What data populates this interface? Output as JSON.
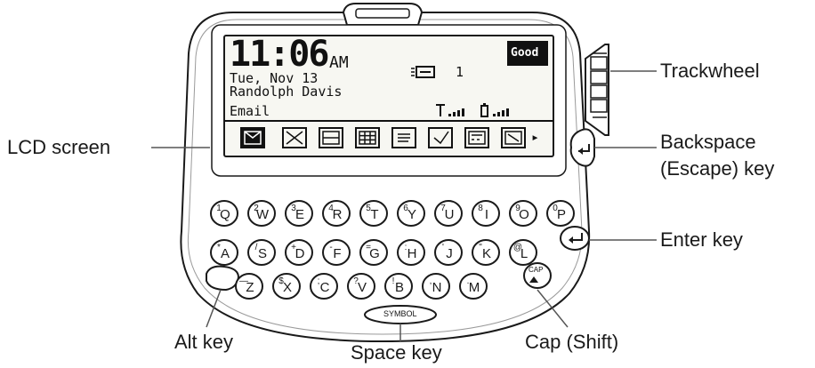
{
  "callouts": {
    "lcd_screen": "LCD screen",
    "trackwheel": "Trackwheel",
    "backspace_line1": "Backspace",
    "backspace_line2": "(Escape) key",
    "enter_key": "Enter key",
    "alt_key": "Alt key",
    "space_key": "Space key",
    "cap_shift": "Cap (Shift)"
  },
  "screen": {
    "time": "11:06",
    "ampm": "AM",
    "date": "Tue, Nov 13",
    "owner": "Randolph Davis",
    "message_count": "1",
    "status_badge": "Good",
    "app_label": "Email",
    "more_arrow": "▸"
  },
  "screen_icons": [
    "email-icon",
    "compose-icon",
    "address-book-icon",
    "calendar-icon",
    "memo-icon",
    "tasks-icon",
    "calculator-icon",
    "options-icon"
  ],
  "keyboard": {
    "rows": [
      [
        {
          "main": "Q",
          "alt": "1"
        },
        {
          "main": "W",
          "alt": "2"
        },
        {
          "main": "E",
          "alt": "3"
        },
        {
          "main": "R",
          "alt": "4"
        },
        {
          "main": "T",
          "alt": "5"
        },
        {
          "main": "Y",
          "alt": "6"
        },
        {
          "main": "U",
          "alt": "7"
        },
        {
          "main": "I",
          "alt": "8"
        },
        {
          "main": "O",
          "alt": "9"
        },
        {
          "main": "P",
          "alt": "0"
        }
      ],
      [
        {
          "main": "A",
          "alt": "*"
        },
        {
          "main": "S",
          "alt": "/"
        },
        {
          "main": "D",
          "alt": "+"
        },
        {
          "main": "F",
          "alt": "-"
        },
        {
          "main": "G",
          "alt": "="
        },
        {
          "main": "H",
          "alt": ":"
        },
        {
          "main": "J",
          "alt": "'"
        },
        {
          "main": "K",
          "alt": "\""
        },
        {
          "main": "L",
          "alt": "@"
        }
      ],
      [
        {
          "main": "Z",
          "alt": "—"
        },
        {
          "main": "X",
          "alt": "$"
        },
        {
          "main": "C",
          "alt": ";"
        },
        {
          "main": "V",
          "alt": "?"
        },
        {
          "main": "B",
          "alt": "!"
        },
        {
          "main": "N",
          "alt": ","
        },
        {
          "main": "M",
          "alt": "."
        }
      ]
    ],
    "cap_key_label": "CAP",
    "symbol_key_label": "SYMBOL"
  }
}
